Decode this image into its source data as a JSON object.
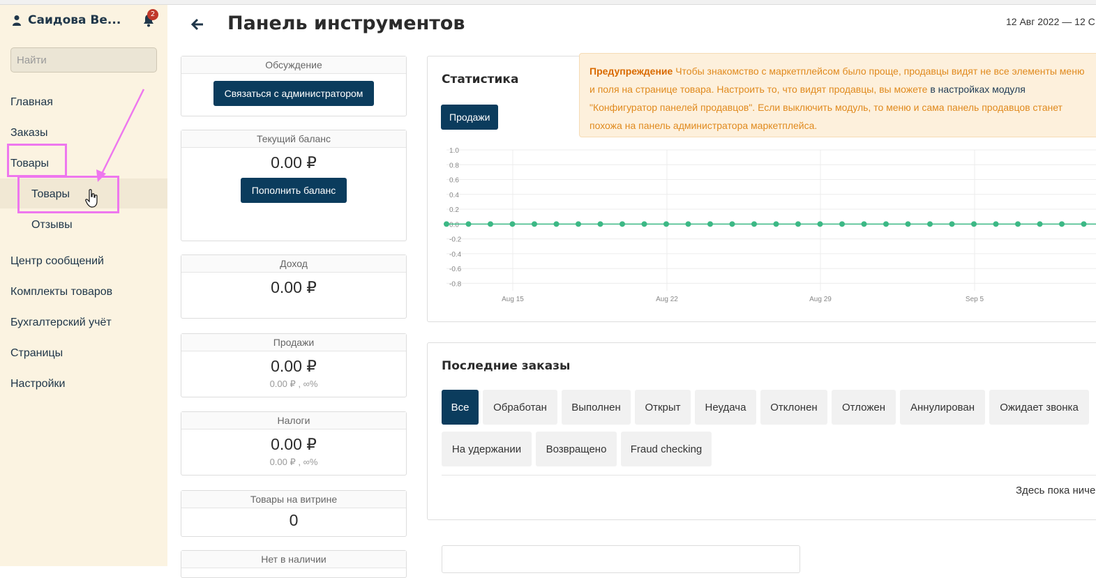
{
  "sidebar": {
    "user_name": "Саидова Ве...",
    "notifications_count": "2",
    "search_placeholder": "Найти",
    "items": [
      {
        "label": "Главная"
      },
      {
        "label": "Заказы"
      },
      {
        "label": "Товары"
      },
      {
        "label": "Товары"
      },
      {
        "label": "Отзывы"
      },
      {
        "label": "Центр сообщений"
      },
      {
        "label": "Комплекты товаров"
      },
      {
        "label": "Бухгалтерский учёт"
      },
      {
        "label": "Страницы"
      },
      {
        "label": "Настройки"
      }
    ]
  },
  "header": {
    "title": "Панель инструментов",
    "date_range": "12 Авг 2022 — 12 С"
  },
  "cards": {
    "discussion": {
      "title": "Обсуждение",
      "button": "Связаться с администратором"
    },
    "balance": {
      "title": "Текущий баланс",
      "value": "0.00 ₽",
      "button": "Пополнить баланс"
    },
    "income": {
      "title": "Доход",
      "value": "0.00 ₽"
    },
    "sales": {
      "title": "Продажи",
      "value": "0.00 ₽",
      "sub": "0.00 ₽ , ∞%"
    },
    "taxes": {
      "title": "Налоги",
      "value": "0.00 ₽",
      "sub": "0.00 ₽ , ∞%"
    },
    "showcase": {
      "title": "Товары на витрине",
      "value": "0"
    },
    "out_of_stock": {
      "title": "Нет в наличии"
    }
  },
  "stats": {
    "title": "Статистика",
    "sales_button": "Продажи"
  },
  "warning": {
    "label": "Предупреждение",
    "text1": " Чтобы знакомство с маркетплейсом было проще, продавцы видят не все элементы меню и поля на странице товара. Настроить то, что видят продавцы, вы можете ",
    "link": "в настройках модуля",
    "text2": " \"Конфигуратор панелей продавцов\". Если выключить модуль, то меню и сама панель продавцов станет похожа на панель администратора маркетплейса."
  },
  "orders": {
    "title": "Последние заказы",
    "tabs": [
      "Все",
      "Обработан",
      "Выполнен",
      "Открыт",
      "Неудача",
      "Отклонен",
      "Отложен",
      "Аннулирован",
      "Ожидает звонка",
      "На удержании",
      "Возвращено",
      "Fraud checking"
    ],
    "empty": "Здесь пока ниче"
  },
  "colors": {
    "accent": "#0b3c5d",
    "sidebar_bg": "#fbf3e1",
    "highlight": "#ee77ee",
    "series": "#3cb885"
  },
  "chart_data": {
    "type": "line",
    "x_ticks": [
      "Aug 15",
      "Aug 22",
      "Aug 29",
      "Sep 5"
    ],
    "y_ticks": [
      1.0,
      0.8,
      0.6,
      0.4,
      0.2,
      0.0,
      -0.2,
      -0.4,
      -0.6,
      -0.8
    ],
    "ylim": [
      -0.9,
      1.0
    ],
    "series": [
      {
        "values": [
          0,
          0,
          0,
          0,
          0,
          0,
          0,
          0,
          0,
          0,
          0,
          0,
          0,
          0,
          0,
          0,
          0,
          0,
          0,
          0,
          0,
          0,
          0,
          0,
          0,
          0,
          0,
          0,
          0,
          0,
          0
        ]
      }
    ]
  }
}
